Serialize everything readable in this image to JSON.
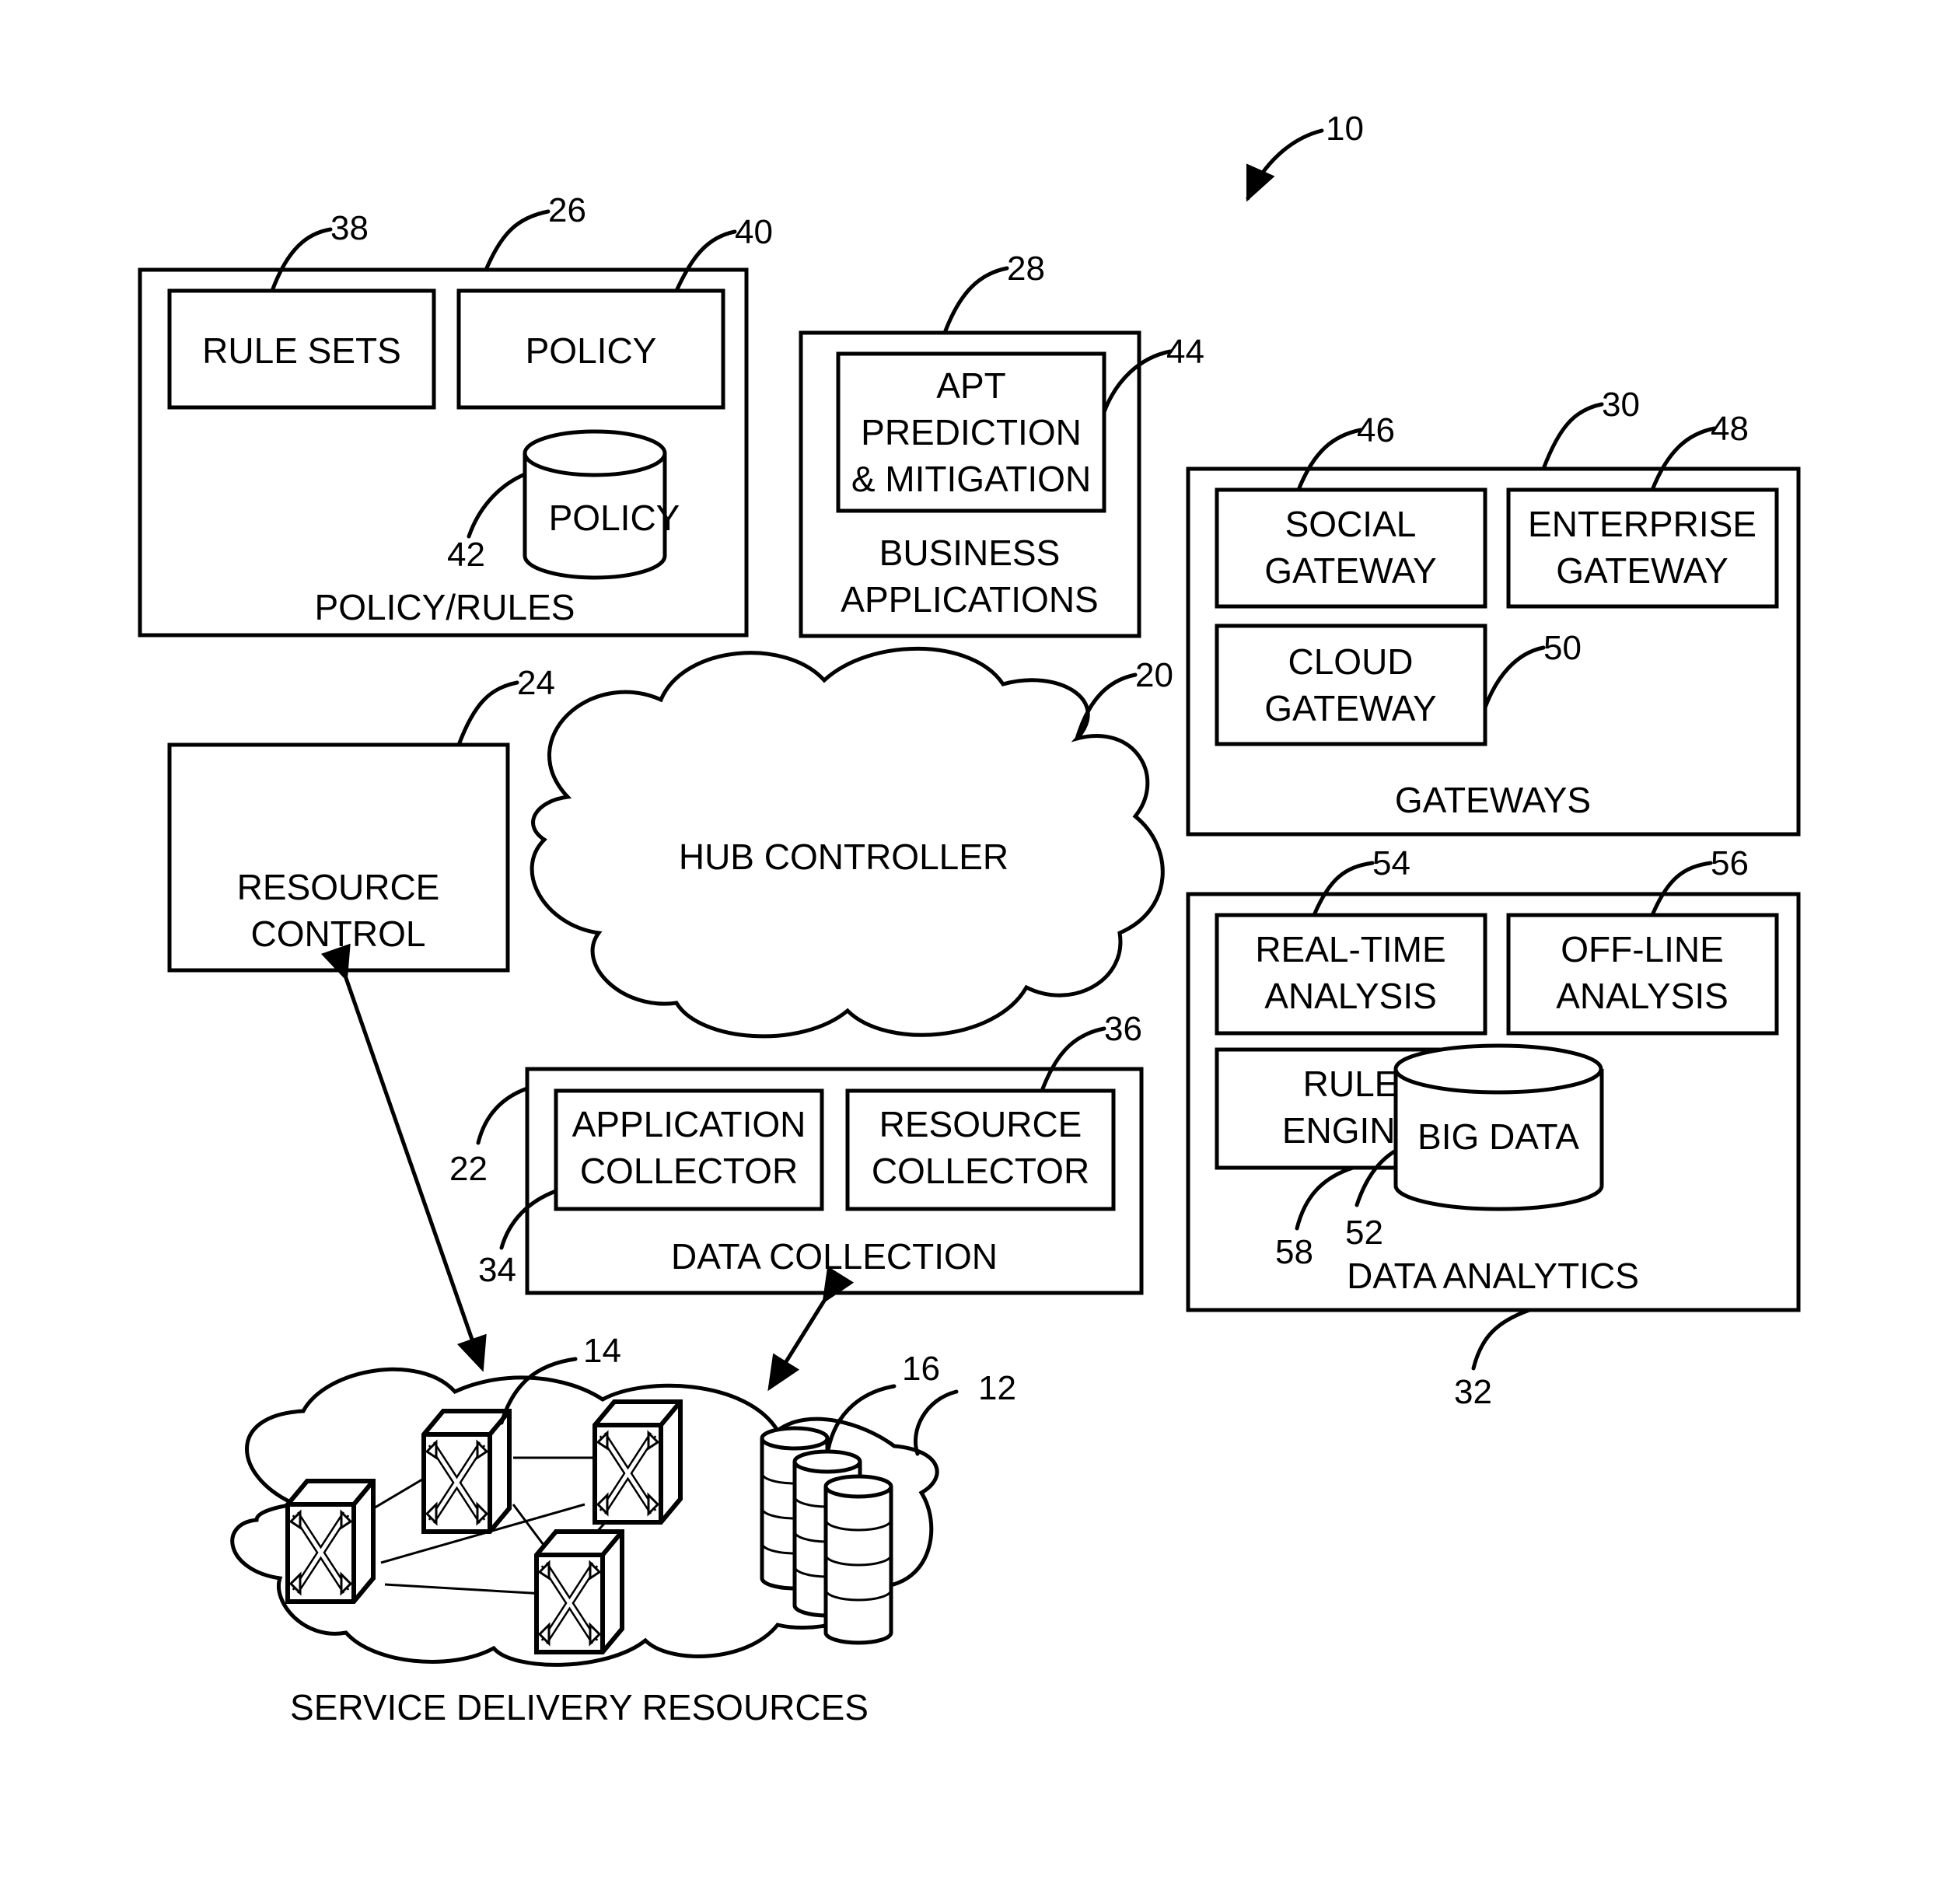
{
  "figure_ref": "10",
  "policy_rules": {
    "ref": "26",
    "title": "POLICY/RULES",
    "rule_sets": {
      "ref": "38",
      "label": "RULE SETS"
    },
    "policy_box": {
      "ref": "40",
      "label": "POLICY"
    },
    "policy_db": {
      "ref": "42",
      "label": "POLICY"
    }
  },
  "business_applications": {
    "ref": "28",
    "title_line1": "BUSINESS",
    "title_line2": "APPLICATIONS",
    "apt": {
      "ref": "44",
      "line1": "APT",
      "line2": "PREDICTION",
      "line3": "& MITIGATION"
    }
  },
  "gateways": {
    "ref": "30",
    "title": "GATEWAYS",
    "social": {
      "ref": "46",
      "line1": "SOCIAL",
      "line2": "GATEWAY"
    },
    "enterprise": {
      "ref": "48",
      "line1": "ENTERPRISE",
      "line2": "GATEWAY"
    },
    "cloud": {
      "ref": "50",
      "line1": "CLOUD",
      "line2": "GATEWAY"
    }
  },
  "resource_control": {
    "ref": "24",
    "line1": "RESOURCE",
    "line2": "CONTROL"
  },
  "hub_controller": {
    "ref": "20",
    "label": "HUB CONTROLLER"
  },
  "data_collection": {
    "ref": "22",
    "title": "DATA COLLECTION",
    "application_collector": {
      "ref": "34",
      "line1": "APPLICATION",
      "line2": "COLLECTOR"
    },
    "resource_collector": {
      "ref": "36",
      "line1": "RESOURCE",
      "line2": "COLLECTOR"
    }
  },
  "data_analytics": {
    "ref": "32",
    "title": "DATA ANALYTICS",
    "real_time": {
      "ref": "54",
      "line1": "REAL-TIME",
      "line2": "ANALYSIS"
    },
    "off_line": {
      "ref": "56",
      "line1": "OFF-LINE",
      "line2": "ANALYSIS"
    },
    "rule_engine": {
      "ref": "58",
      "line1": "RULE",
      "line2": "ENGINE"
    },
    "big_data": {
      "ref": "52",
      "label": "BIG DATA"
    }
  },
  "service_delivery": {
    "ref": "12",
    "title": "SERVICE DELIVERY RESOURCES",
    "switches_ref": "14",
    "storage_ref": "16"
  }
}
